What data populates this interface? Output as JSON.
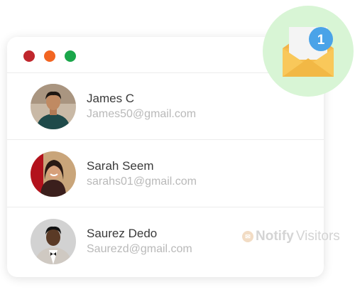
{
  "window": {
    "controls": [
      {
        "name": "close",
        "color": "#c0272d"
      },
      {
        "name": "minimize",
        "color": "#f26522"
      },
      {
        "name": "maximize",
        "color": "#1aa64a"
      }
    ]
  },
  "contacts": [
    {
      "name": "James C",
      "email": "James50@gmail.com"
    },
    {
      "name": "Sarah Seem",
      "email": "sarahs01@gmail.com"
    },
    {
      "name": "Saurez Dedo",
      "email": "Saurezd@gmail.com"
    }
  ],
  "notification": {
    "count": "1",
    "badge_color": "#4aa3e8",
    "envelope_color": "#f6be4f"
  },
  "watermark": {
    "brand_bold": "Notify",
    "brand_light": "Visitors"
  }
}
